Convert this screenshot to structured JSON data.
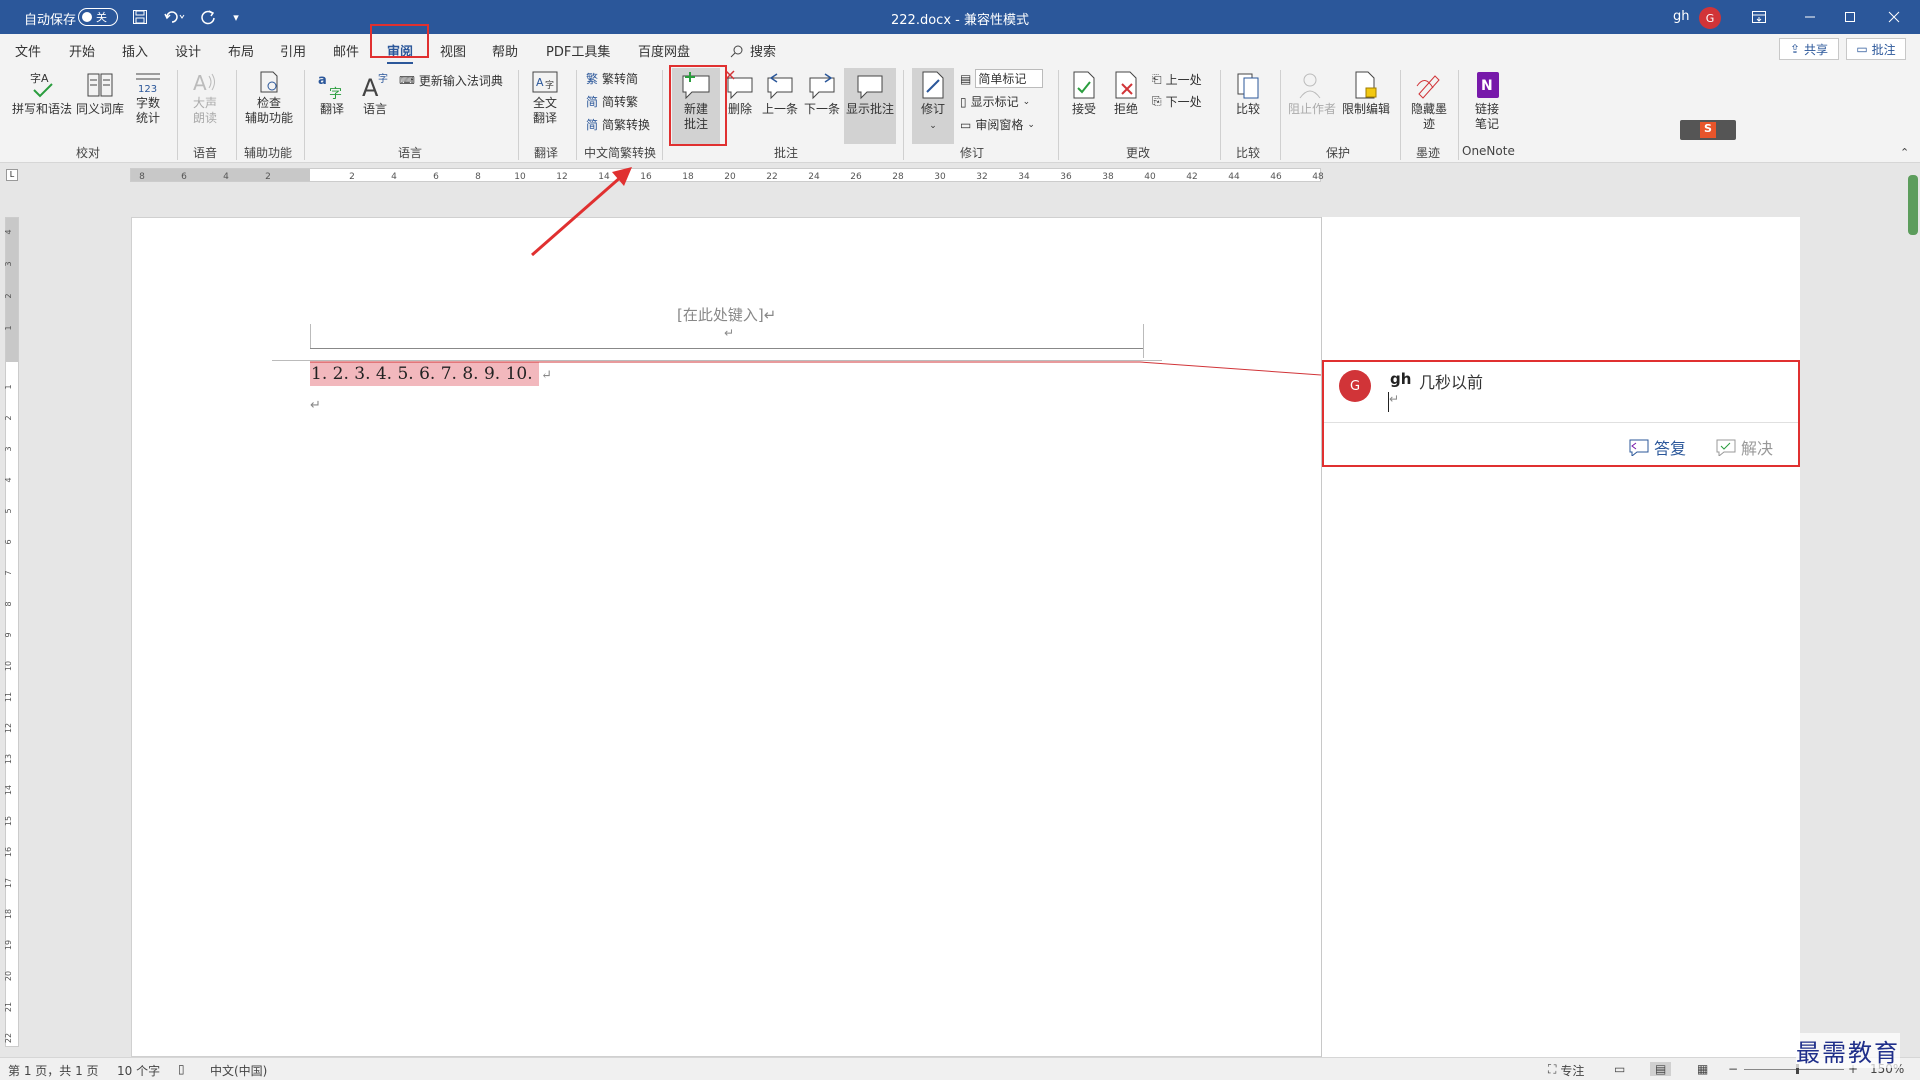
{
  "titlebar": {
    "autosave_label": "自动保存",
    "autosave_state": "关",
    "doc_title": "222.docx  -  兼容性模式",
    "user": "gh",
    "avatar": "G"
  },
  "tabs": [
    "文件",
    "开始",
    "插入",
    "设计",
    "布局",
    "引用",
    "邮件",
    "审阅",
    "视图",
    "帮助",
    "PDF工具集",
    "百度网盘"
  ],
  "search_label": "搜索",
  "share_label": "共享",
  "comments_label": "批注",
  "ribbon": {
    "spelling": "拼写和语法",
    "thesaurus": "同义词库",
    "wordcount_1": "字数",
    "wordcount_2": "统计",
    "readaloud_1": "大声",
    "readaloud_2": "朗读",
    "accessibility_1": "检查",
    "accessibility_2": "辅助功能",
    "translate": "翻译",
    "language": "语言",
    "update_ime": "更新输入法词典",
    "fulltrans_1": "全文",
    "fulltrans_2": "翻译",
    "t2s": "繁转简",
    "s2t": "简转繁",
    "convert": "简繁转换",
    "newcomment_1": "新建",
    "newcomment_2": "批注",
    "delete": "删除",
    "prev": "上一条",
    "next": "下一条",
    "show": "显示批注",
    "track": "修订",
    "simple_markup": "简单标记",
    "show_markup": "显示标记",
    "review_pane": "审阅窗格",
    "accept": "接受",
    "reject": "拒绝",
    "prev_change": "上一处",
    "next_change": "下一处",
    "compare": "比较",
    "block_authors": "阻止作者",
    "restrict": "限制编辑",
    "hide_ink_1": "隐藏墨",
    "hide_ink_2": "迹",
    "onenote_1": "链接",
    "onenote_2": "笔记",
    "groups": {
      "proofing": "校对",
      "speech": "语音",
      "accessibility": "辅助功能",
      "language": "语言",
      "translation": "翻译",
      "chinese": "中文简繁转换",
      "comments": "批注",
      "tracking": "修订",
      "changes": "更改",
      "compare": "比较",
      "protect": "保护",
      "ink": "墨迹",
      "onenote": "OneNote"
    }
  },
  "ruler_numbers": [
    "8",
    "6",
    "4",
    "2",
    "2",
    "4",
    "6",
    "8",
    "10",
    "12",
    "14",
    "16",
    "18",
    "20",
    "22",
    "24",
    "26",
    "28",
    "30",
    "32",
    "34",
    "36",
    "38",
    "40",
    "42",
    "44",
    "46",
    "48"
  ],
  "vruler_numbers": [
    "4",
    "3",
    "2",
    "1",
    "1",
    "2",
    "3",
    "4",
    "5",
    "6",
    "7",
    "8",
    "9",
    "10",
    "11",
    "12",
    "13",
    "14",
    "15",
    "16",
    "17",
    "18",
    "19",
    "20",
    "21",
    "22"
  ],
  "document": {
    "header_placeholder": "[在此处键入]↵",
    "header_mark": "↵",
    "body_text": "1. 2. 3. 4. 5. 6. 7. 8. 9. 10. ",
    "para_mark": "↵",
    "empty_para": "↵"
  },
  "comment": {
    "avatar": "G",
    "author": "gh",
    "time": "几秒以前",
    "body": "↵",
    "reply": "答复",
    "resolve": "解决"
  },
  "status": {
    "page": "第 1 页，共 1 页",
    "words": "10 个字",
    "language": "中文(中国)",
    "focus": "专注",
    "zoom": "150%"
  },
  "watermark": "最需教育",
  "colors": {
    "titlebar": "#2b579a",
    "accent_red": "#e03030",
    "highlight": "#f2b8bd",
    "avatar": "#d13438"
  }
}
